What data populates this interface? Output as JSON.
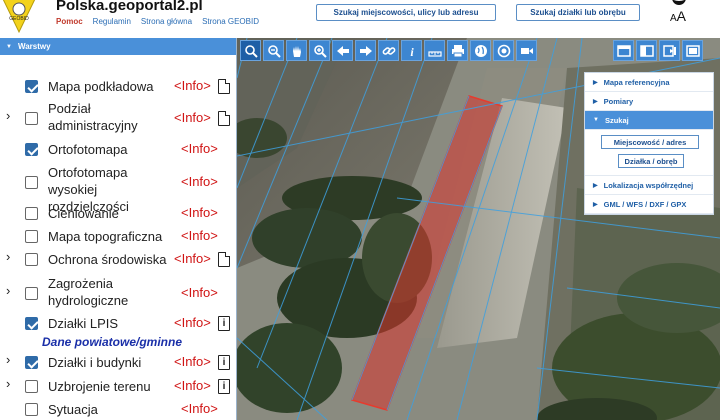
{
  "header": {
    "title": "Polska.geoportal2.pl",
    "logo_text": "GEOBID",
    "links": {
      "help": "Pomoc",
      "rules": "Regulamin",
      "home": "Strona główna",
      "geobid": "Strona GEOBID"
    },
    "search_address_button": "Szukaj miejscowości, ulicy lub adresu",
    "search_parcel_button": "Szukaj działki lub obrębu",
    "font_size_label": "A",
    "font_size_label_large": "A"
  },
  "panel": {
    "title": "Warstwy",
    "section_label": "Dane powiatowe/gminne",
    "layers": [
      {
        "name": "Mapa podkładowa",
        "checked": true,
        "expandable": false,
        "info": "<Info>",
        "doc": "page"
      },
      {
        "name": "Podział administracyjny",
        "checked": false,
        "expandable": true,
        "info": "<Info>",
        "doc": "page"
      },
      {
        "name": "Ortofotomapa",
        "checked": true,
        "expandable": false,
        "info": "<Info>",
        "doc": ""
      },
      {
        "name": "Ortofotomapa wysokiej rozdzielczości",
        "checked": false,
        "expandable": false,
        "info": "<Info>",
        "doc": ""
      },
      {
        "name": "Cieniowanie",
        "checked": false,
        "expandable": false,
        "info": "<Info>",
        "doc": ""
      },
      {
        "name": "Mapa topograficzna",
        "checked": false,
        "expandable": false,
        "info": "<Info>",
        "doc": ""
      },
      {
        "name": "Ochrona środowiska",
        "checked": false,
        "expandable": true,
        "info": "<Info>",
        "doc": "page"
      },
      {
        "name": "Zagrożenia hydrologiczne",
        "checked": false,
        "expandable": true,
        "info": "<Info>",
        "doc": ""
      },
      {
        "name": "Działki LPIS",
        "checked": true,
        "expandable": false,
        "info": "<Info>",
        "doc": "info"
      },
      {
        "name": "Działki i budynki",
        "checked": true,
        "expandable": true,
        "info": "<Info>",
        "doc": "info"
      },
      {
        "name": "Uzbrojenie terenu",
        "checked": false,
        "expandable": true,
        "info": "<Info>",
        "doc": "info"
      },
      {
        "name": "Sytuacja",
        "checked": false,
        "expandable": false,
        "info": "<Info>",
        "doc": ""
      }
    ]
  },
  "toolbar": {
    "tools": [
      "zoom-window-icon",
      "zoom-out-icon",
      "pan-hand-icon",
      "zoom-in-icon",
      "arrow-left-icon",
      "arrow-right-icon",
      "link-icon",
      "info-icon",
      "measure-icon",
      "print-icon",
      "globe-icon",
      "locate-icon",
      "video-icon"
    ],
    "right_tools": [
      "window-icon",
      "split-view-icon",
      "export-icon",
      "fullscreen-icon"
    ]
  },
  "side_menu": {
    "reference_map": "Mapa referencyjna",
    "measurements": "Pomiary",
    "search": "Szukaj",
    "search_address": "Miejscowość / adres",
    "search_parcel": "Działka / obręb",
    "coordinates": "Lokalizacja współrzędnej",
    "formats": "GML / WFS / DXF / GPX"
  },
  "colors": {
    "accent": "#4a90d9",
    "info": "#d01414",
    "section": "#1a2fa8",
    "parcel": "#d9342b"
  }
}
